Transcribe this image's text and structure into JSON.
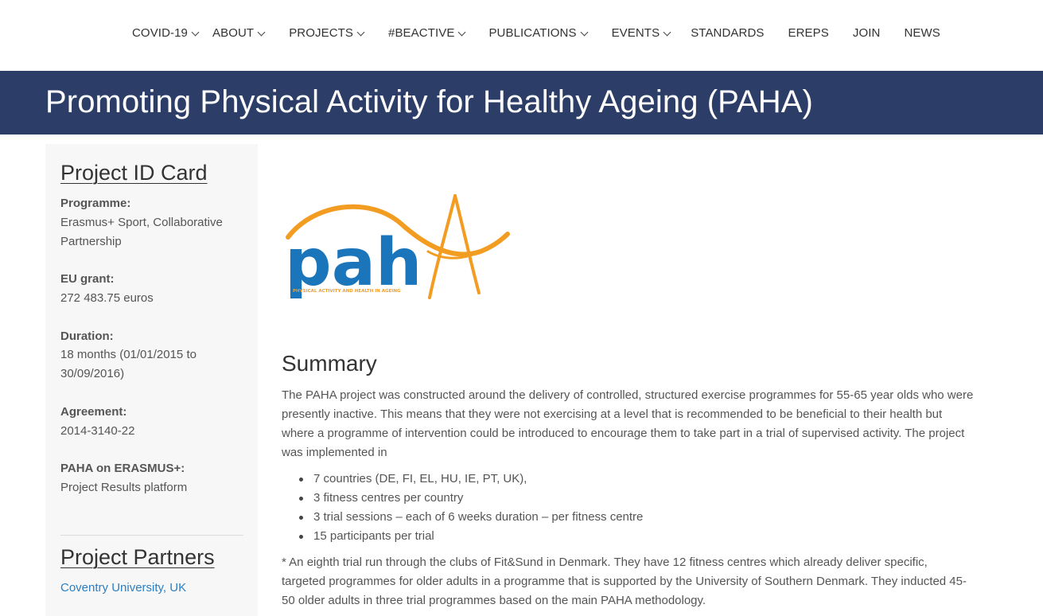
{
  "nav": {
    "items": [
      {
        "label": "COVID-19",
        "dropdown": true
      },
      {
        "label": "ABOUT",
        "dropdown": true
      },
      {
        "label": "PROJECTS",
        "dropdown": true
      },
      {
        "label": "#BEACTIVE",
        "dropdown": true
      },
      {
        "label": "PUBLICATIONS",
        "dropdown": true
      },
      {
        "label": "EVENTS",
        "dropdown": true
      },
      {
        "label": "STANDARDS",
        "dropdown": false
      },
      {
        "label": "EREPS",
        "dropdown": false
      },
      {
        "label": "JOIN",
        "dropdown": false
      },
      {
        "label": "NEWS",
        "dropdown": false
      }
    ]
  },
  "page": {
    "title": "Promoting Physical Activity for Healthy Ageing (PAHA)"
  },
  "sidebar": {
    "id_card_heading": "Project ID Card",
    "programme_label": "Programme:",
    "programme_value": "Erasmus+ Sport, Collaborative Partnership",
    "grant_label": "EU grant:",
    "grant_value": "272 483.75 euros",
    "duration_label": "Duration:",
    "duration_value": "18 months (01/01/2015 to 30/09/2016)",
    "agreement_label": "Agreement:",
    "agreement_value": "2014-3140-22",
    "erasmus_label": "PAHA on ERASMUS+:",
    "erasmus_value": "Project Results platform",
    "partners_heading": "Project Partners",
    "partners": [
      "Coventry University, UK"
    ]
  },
  "logo": {
    "text": "pah",
    "tagline": "PHYSICAL ACTIVITY AND HEALTH IN AGEING",
    "colors": {
      "blue": "#1b75bb",
      "orange": "#f39c22"
    }
  },
  "main": {
    "summary_heading": "Summary",
    "intro": "The PAHA project was constructed around the delivery of controlled, structured exercise programmes for 55-65 year olds who were presently inactive. This means that they were not exercising at a level that is recommended to be beneficial to their health but where a programme of intervention could be introduced to encourage them to take part in a trial of supervised activity. The project was implemented in",
    "bullets": [
      "7 countries (DE, FI, EL, HU, IE, PT, UK),",
      "3 fitness centres per country",
      "3 trial sessions – each of 6 weeks duration – per fitness centre",
      "15 participants per trial"
    ],
    "footnote": "* An eighth trial run through the clubs of Fit&Sund in Denmark. They have 12 fitness centres which already deliver specific, targeted programmes for older adults in a programme that is supported by the University of Southern Denmark. They inducted 45-50 older adults in three trial programmes based on the main PAHA methodology."
  },
  "colors": {
    "title_bar": "#2c3e67",
    "link": "#2a7fc4",
    "sidebar_bg": "#f7f7f7"
  }
}
